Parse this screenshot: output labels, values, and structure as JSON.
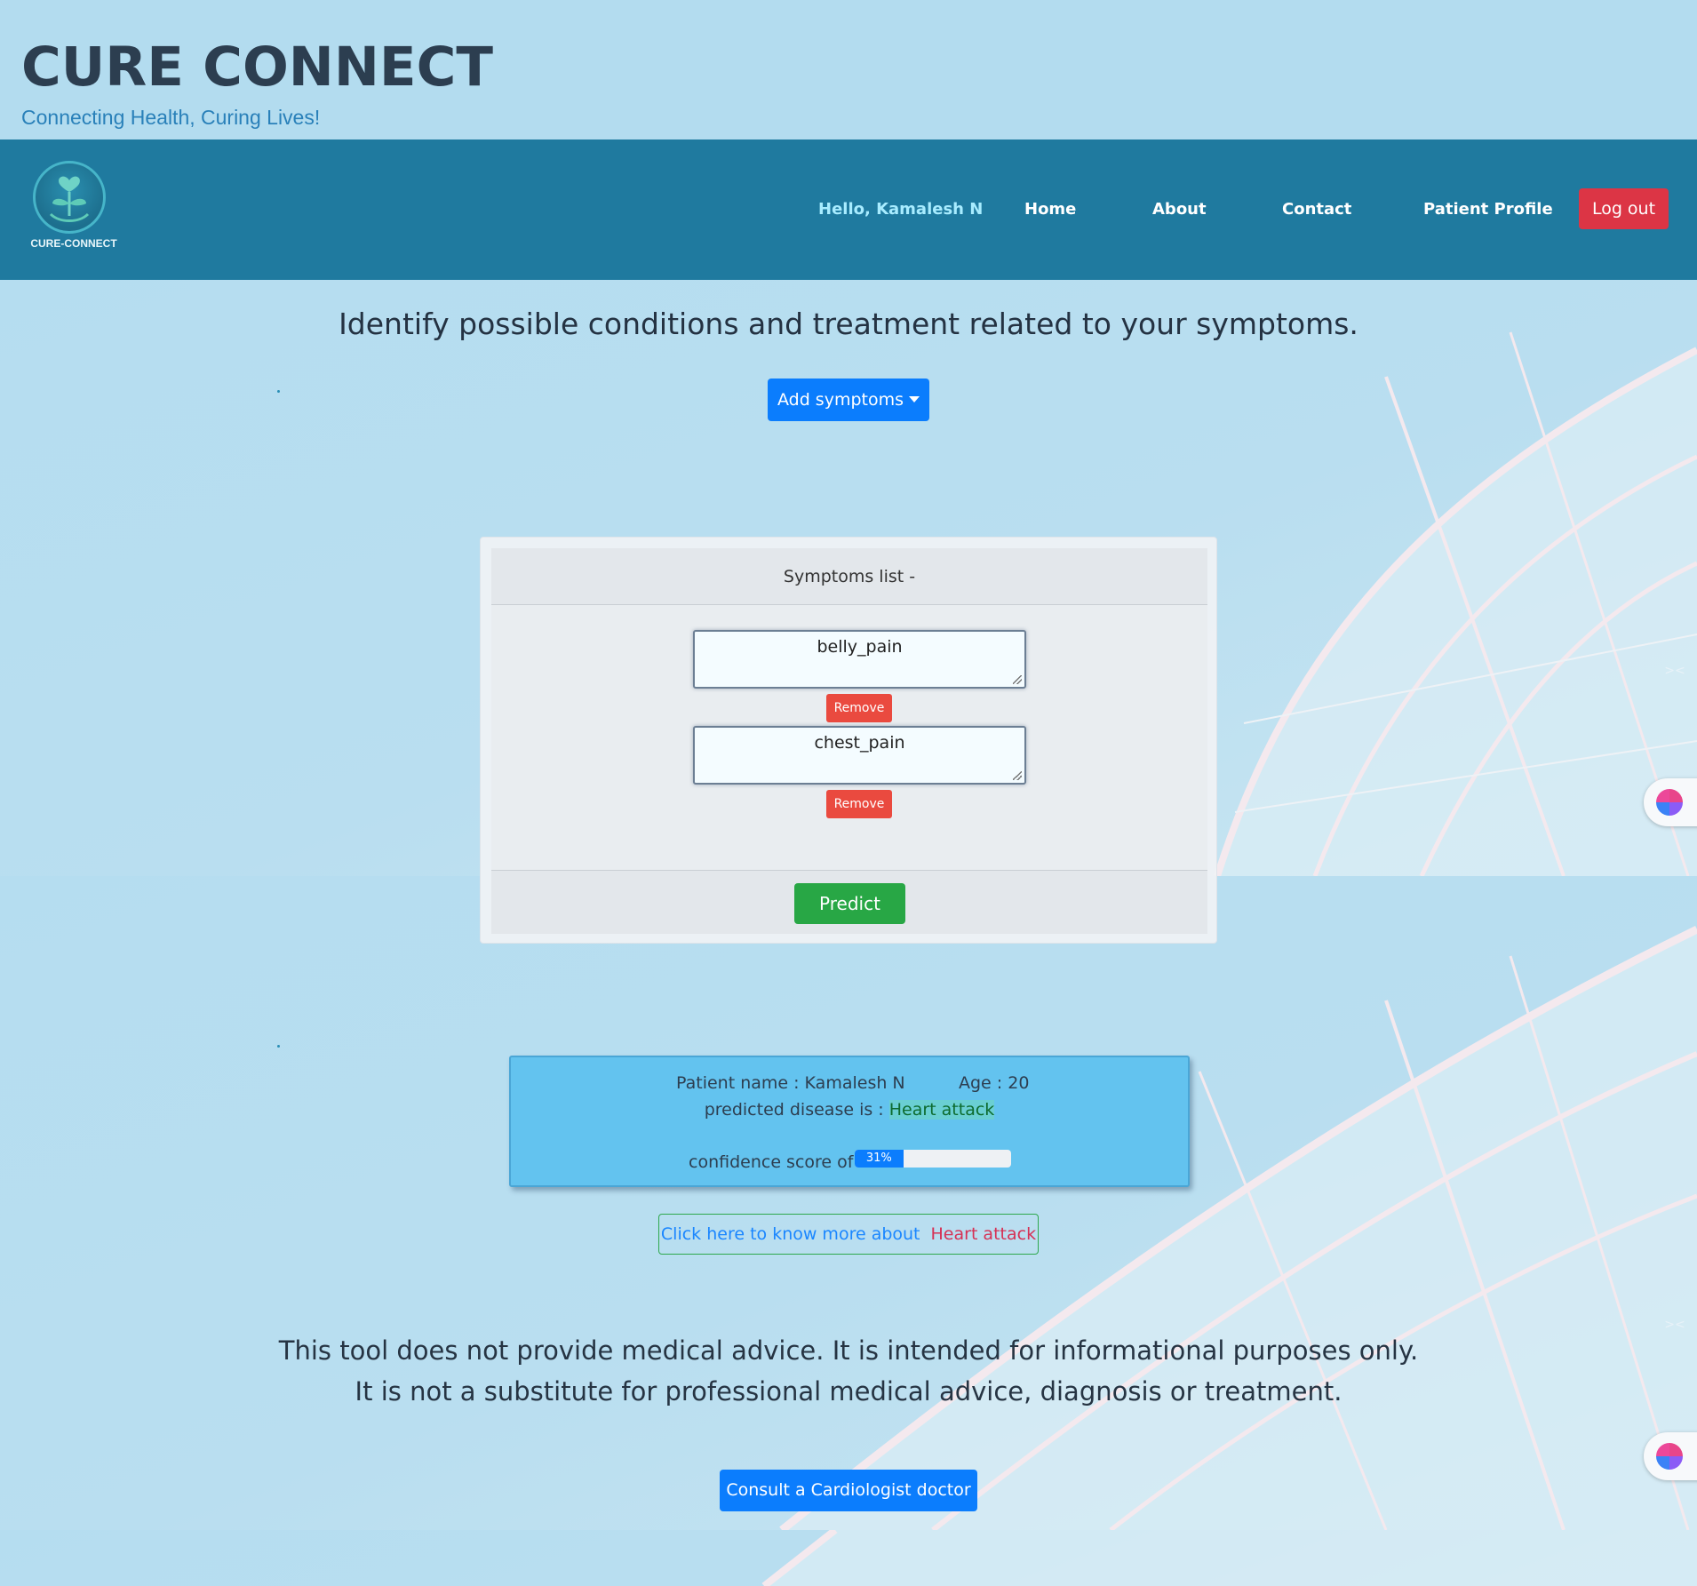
{
  "header": {
    "title": "CURE CONNECT",
    "tagline": "Connecting Health, Curing Lives!"
  },
  "nav": {
    "logo_text": "CURE-CONNECT",
    "greeting": "Hello, Kamalesh N",
    "items": [
      "Home",
      "About",
      "Contact",
      "Patient Profile"
    ],
    "logout_label": "Log out"
  },
  "main": {
    "heading": "Identify possible conditions and treatment related to your symptoms.",
    "add_symptoms_label": "Add symptoms"
  },
  "symptoms_card": {
    "header": "Symptoms list -",
    "symptoms": [
      "belly_pain",
      "chest_pain"
    ],
    "remove_label": "Remove",
    "predict_label": "Predict"
  },
  "result": {
    "patient_label": "Patient name : Kamalesh N",
    "age_label": "Age : 20",
    "predicted_prefix": "predicted disease is : ",
    "disease": "Heart attack",
    "confidence_label": "confidence score of :",
    "confidence_percent": 31,
    "confidence_text": "31%"
  },
  "know_more": {
    "text": "Click here to know more about",
    "disease": "Heart attack"
  },
  "disclaimer": {
    "line1": "This tool does not provide medical advice. It is intended for informational purposes only.",
    "line2": "It is not a substitute for professional medical advice, diagnosis or treatment."
  },
  "consult_label": "Consult a Cardiologist doctor",
  "colors": {
    "navbar": "#1f7a9f",
    "primary": "#0b7dfd",
    "danger": "#dc3545",
    "success": "#28a745",
    "result_bg": "#63c3ef"
  },
  "icons": {
    "logo": "leaf-heart-logo-icon",
    "caret": "caret-down-icon",
    "side_widget": "brain-icon",
    "side_close": "close-icon"
  }
}
